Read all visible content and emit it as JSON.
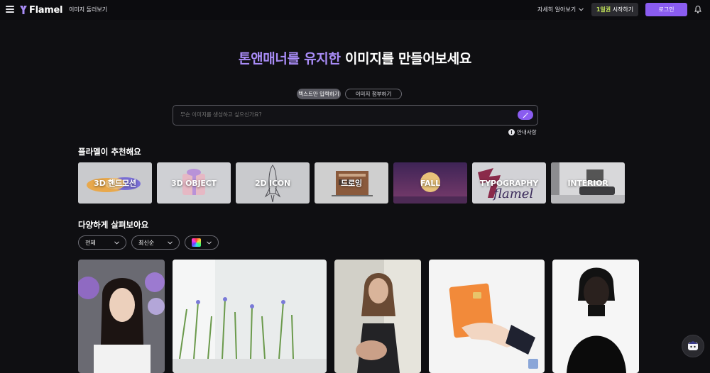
{
  "nav": {
    "brand": "Flamel",
    "browse_link": "이미지 둘러보기",
    "learn_more": "자세히 알아보기",
    "trial_highlight": "1일권",
    "trial_rest": " 시작하기",
    "login": "로그인"
  },
  "hero": {
    "title_accent": "톤앤매너를 유지한",
    "title_rest": " 이미지를 만들어보세요",
    "tabs": [
      "텍스트만 입력하기",
      "이미지 첨부하기"
    ],
    "active_tab": "텍스트만 입력하기",
    "prompt_placeholder": "무슨 이미지를 생성하고 싶으신가요?",
    "info_label": "안내사항"
  },
  "recommend": {
    "title": "플라멜이 추천해요",
    "cards": [
      "3D 핸드모션",
      "3D OBJECT",
      "2D ICON",
      "드로잉",
      "FALL",
      "TYPOGRAPHY",
      "INTERIOR"
    ]
  },
  "browse": {
    "title": "다양하게 살펴보아요",
    "filters": [
      "전체",
      "최신순"
    ],
    "color_filter_icon": "color-palette-icon"
  },
  "gallery": {
    "items": [
      "portrait-woman-flowers",
      "grass-flowers-white-room",
      "woman-sitting-chair",
      "hand-holding-orange-card",
      "man-black-turtleneck"
    ]
  },
  "colors": {
    "accent": "#8a5cf0",
    "accent_text": "#a98cf7",
    "trial_highlight": "#c6e85a",
    "background": "#0f0f12"
  }
}
